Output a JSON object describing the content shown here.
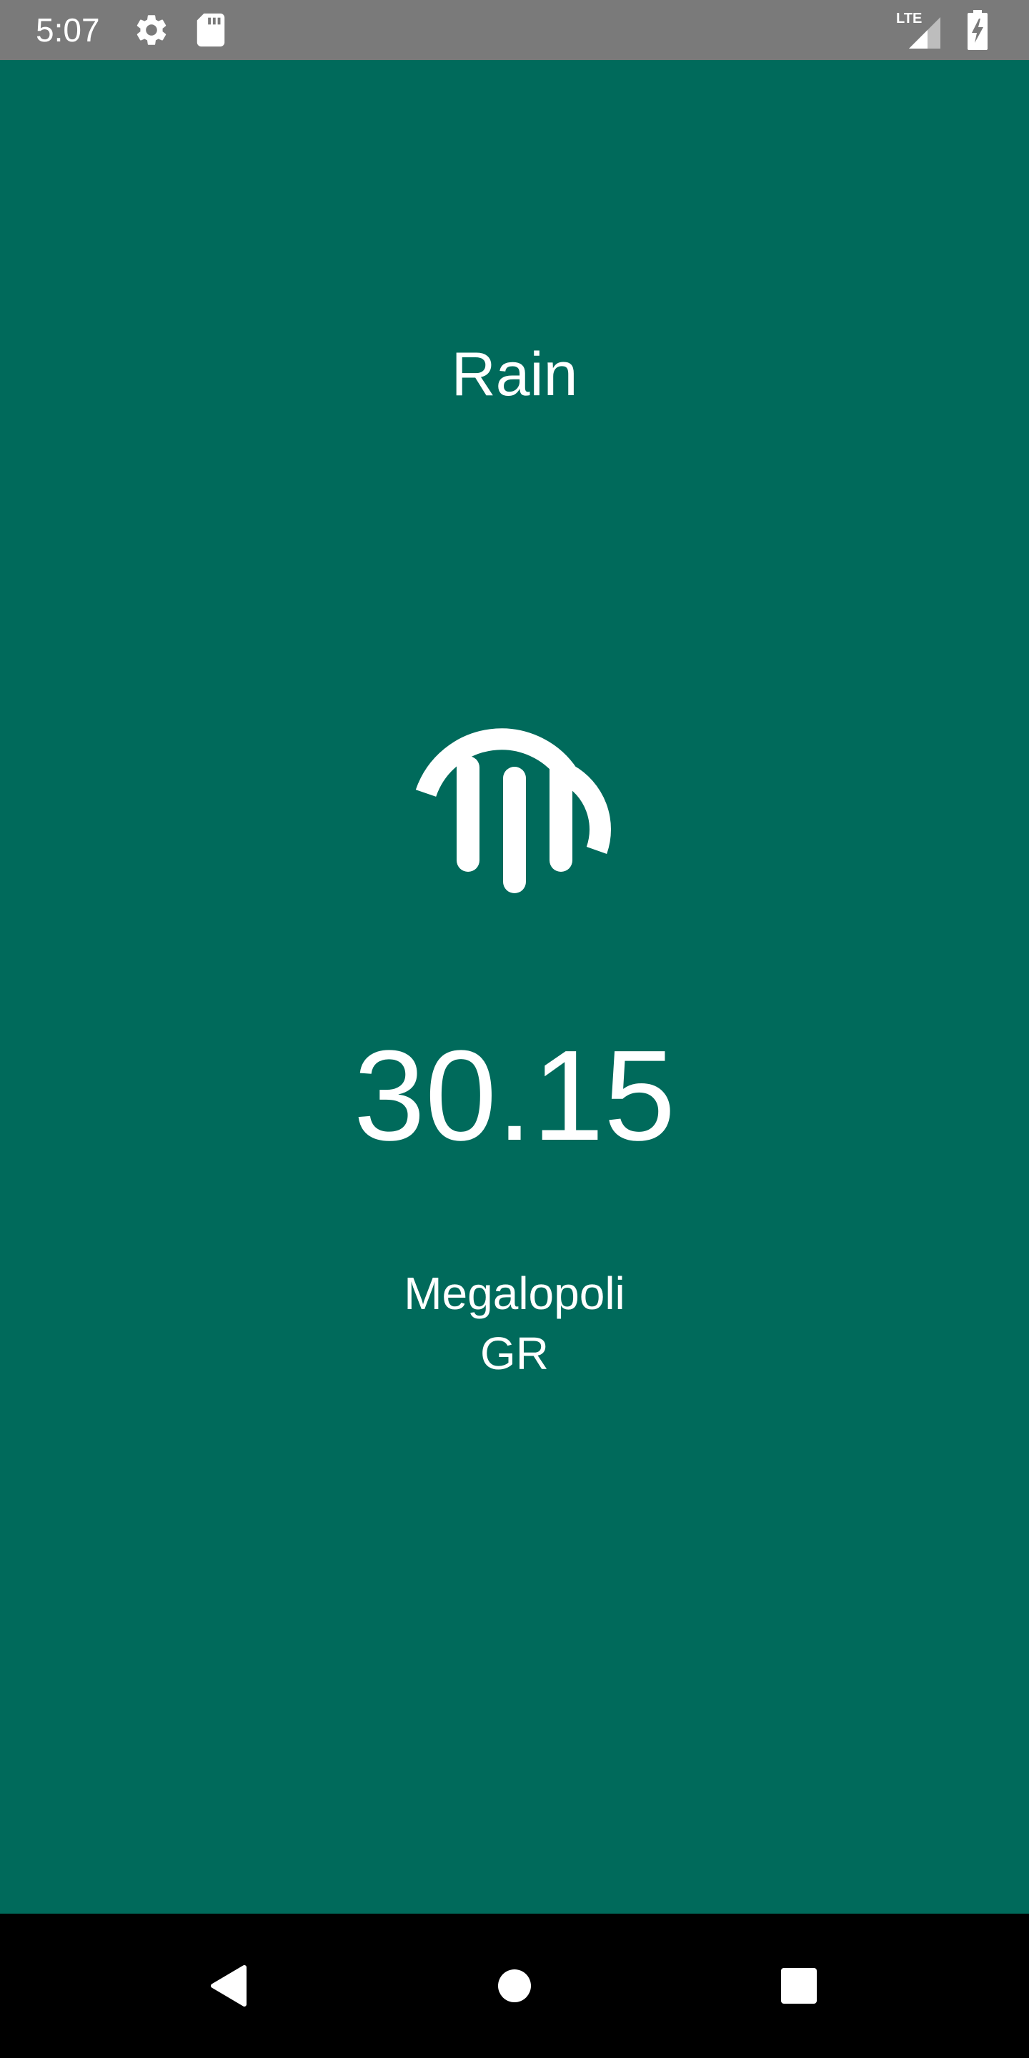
{
  "status_bar": {
    "time": "5:07",
    "icons": [
      "settings-gear-icon",
      "sd-card-icon",
      "lte-signal-icon",
      "battery-charging-icon"
    ],
    "network_label": "LTE"
  },
  "weather": {
    "condition": "Rain",
    "icon": "rain-cloud-icon",
    "temperature": "30.15",
    "city": "Megalopoli",
    "country": "GR"
  },
  "nav_bar": {
    "buttons": [
      "back-icon",
      "home-icon",
      "recents-icon"
    ]
  },
  "colors": {
    "background": "#006a5b",
    "status_bar": "#7a7a7a",
    "nav_bar": "#000000",
    "text": "#ffffff"
  }
}
